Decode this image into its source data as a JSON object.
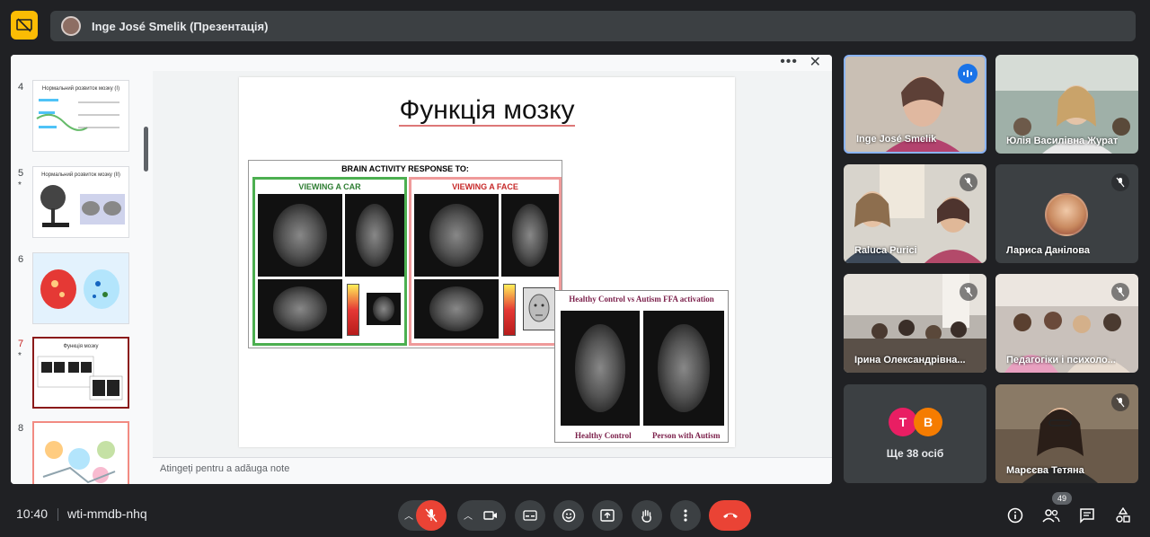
{
  "header": {
    "presenter_label": "Inge José Smelik (Презентація)"
  },
  "presentation": {
    "notes_placeholder": "Atingeți pentru a adăuga note",
    "thumbnails": [
      {
        "num": "4",
        "star": "",
        "title": "Нормальний розвиток мозку (I)"
      },
      {
        "num": "5",
        "star": "*",
        "title": "Нормальний розвиток мозку (II)"
      },
      {
        "num": "6",
        "star": "",
        "title": ""
      },
      {
        "num": "7",
        "star": "*",
        "title": "Функція мозку"
      },
      {
        "num": "8",
        "star": "",
        "title": ""
      }
    ],
    "slide": {
      "title": "Функція мозку",
      "brain_header": "BRAIN ACTIVITY RESPONSE TO:",
      "car_label": "VIEWING A CAR",
      "face_label": "VIEWING A FACE",
      "autism_header": "Healthy Control vs Autism FFA activation",
      "caption_left": "Healthy Control",
      "caption_right": "Person with Autism"
    }
  },
  "participants": [
    {
      "name": "Inge José Smelik",
      "state": "speaking"
    },
    {
      "name": "Юлія Василівна Журат",
      "state": "none"
    },
    {
      "name": "Raluca Purici",
      "state": "muted"
    },
    {
      "name": "Лариса Данілова",
      "state": "muted"
    },
    {
      "name": "Ірина Олександрівна...",
      "state": "muted"
    },
    {
      "name": "Педагогіки і психоло...",
      "state": "muted"
    },
    {
      "name": "Марєєва Тетяна",
      "state": "muted"
    }
  ],
  "others": {
    "avatars": [
      "T",
      "B"
    ],
    "label": "Ще 38 осіб",
    "avatar_colors": [
      "#e91e63",
      "#f57c00"
    ]
  },
  "footer": {
    "time": "10:40",
    "meeting_code": "wti-mmdb-nhq",
    "participant_count": "49"
  },
  "colors": {
    "accent": "#8ab4f8",
    "danger": "#ea4335",
    "present_badge": "#fbbc04"
  }
}
